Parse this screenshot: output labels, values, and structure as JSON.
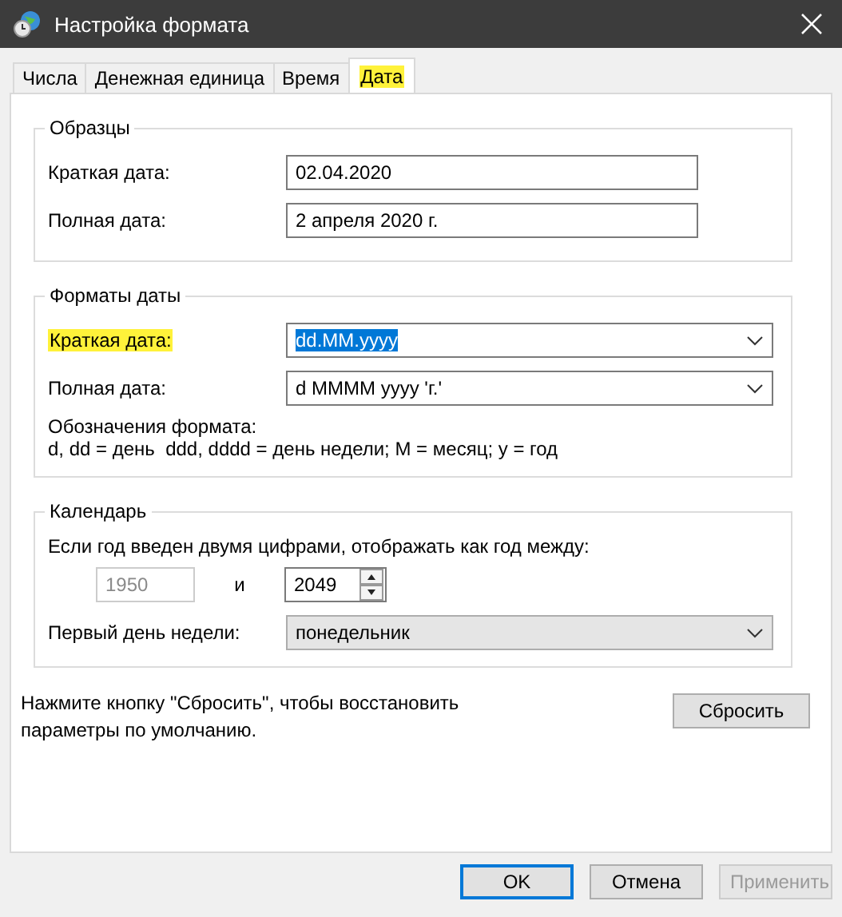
{
  "window": {
    "title": "Настройка формата"
  },
  "tabs": [
    {
      "label": "Числа",
      "selected": false,
      "highlighted": false
    },
    {
      "label": "Денежная единица",
      "selected": false,
      "highlighted": false
    },
    {
      "label": "Время",
      "selected": false,
      "highlighted": false
    },
    {
      "label": "Дата",
      "selected": true,
      "highlighted": true
    }
  ],
  "samples": {
    "title": "Образцы",
    "rows": [
      {
        "label": "Краткая дата:",
        "value": "02.04.2020"
      },
      {
        "label": "Полная дата:",
        "value": "2 апреля 2020 г."
      }
    ]
  },
  "date_formats": {
    "title": "Форматы даты",
    "rows": [
      {
        "label": "Краткая дата:",
        "value": "dd.MM.yyyy",
        "highlighted": true,
        "text_selected": true
      },
      {
        "label": "Полная дата:",
        "value": "d MMMM yyyy 'г.'",
        "highlighted": false,
        "text_selected": false
      }
    ],
    "notation_title": "Обозначения формата:",
    "notation": "d, dd = день  ddd, dddd = день недели; M = месяц; y = год"
  },
  "calendar": {
    "title": "Календарь",
    "range_label": "Если год введен двумя цифрами, отображать как год между:",
    "year_from": {
      "value": "1950",
      "disabled": true
    },
    "and_label": "и",
    "year_to": {
      "value": "2049",
      "disabled": false
    },
    "first_day_label": "Первый день недели:",
    "first_day": "понедельник"
  },
  "reset_note": "Нажмите кнопку \"Сбросить\", чтобы восстановить параметры по умолчанию.",
  "reset_button": "Сбросить",
  "buttons": [
    {
      "label": "OK",
      "default": true,
      "disabled": false
    },
    {
      "label": "Отмена",
      "default": false,
      "disabled": false
    },
    {
      "label": "Применить",
      "default": false,
      "disabled": true
    }
  ]
}
